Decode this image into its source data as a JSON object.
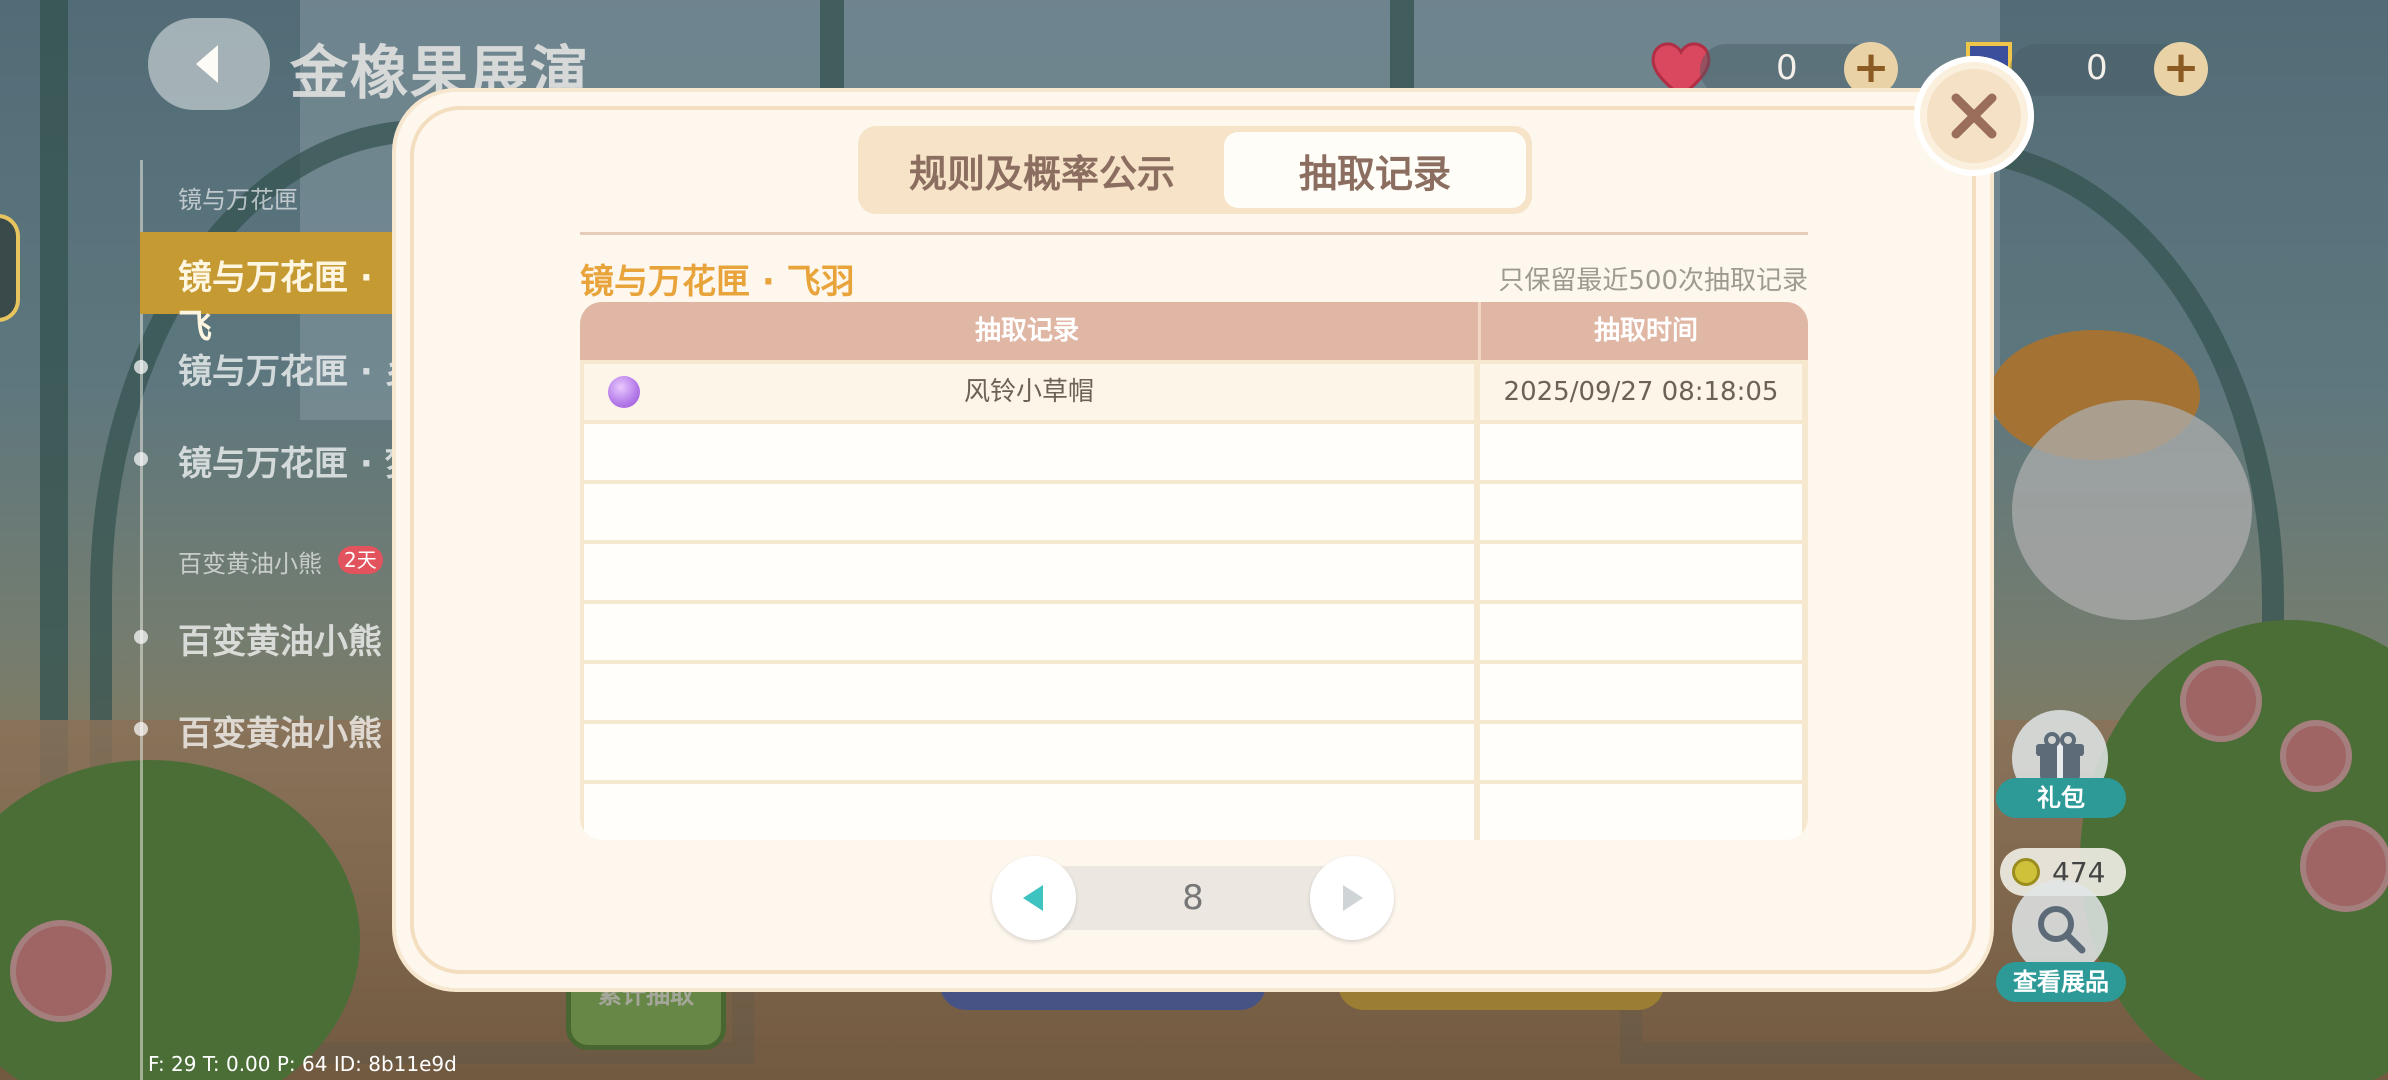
{
  "header": {
    "title": "金橡果展演",
    "currencies": [
      {
        "name": "heart",
        "value": "0"
      },
      {
        "name": "badge",
        "value": "0"
      }
    ]
  },
  "sidebar": {
    "groups": [
      {
        "label": "镜与万花匣",
        "items": [
          "镜与万花匣 · 飞",
          "镜与万花匣 · 乡",
          "镜与万花匣 · 梦"
        ]
      },
      {
        "label": "百变黄油小熊",
        "badge": "2天",
        "items": [
          "百变黄油小熊",
          "百变黄油小熊"
        ]
      }
    ]
  },
  "right_widgets": {
    "gift_label": "礼包",
    "coin_value": "474",
    "view_label": "查看展品"
  },
  "under_buttons": {
    "cumulative_label": "累计抽取"
  },
  "debug": "F: 29   T: 0.00   P: 64   ID: 8b11e9d",
  "dialog": {
    "tabs": [
      {
        "label": "规则及概率公示",
        "active": false
      },
      {
        "label": "抽取记录",
        "active": true
      }
    ],
    "section_title": "镜与万花匣 · 飞羽",
    "keep_note": "只保留最近500次抽取记录",
    "table": {
      "headers": [
        "抽取记录",
        "抽取时间"
      ],
      "rows": [
        {
          "item": "风铃小草帽",
          "time": "2025/09/27 08:18:05",
          "rarity_color": "#b278e8"
        },
        {
          "item": "",
          "time": ""
        },
        {
          "item": "",
          "time": ""
        },
        {
          "item": "",
          "time": ""
        },
        {
          "item": "",
          "time": ""
        },
        {
          "item": "",
          "time": ""
        },
        {
          "item": "",
          "time": ""
        },
        {
          "item": "",
          "time": ""
        }
      ]
    },
    "pager": {
      "page": "8"
    }
  },
  "colors": {
    "accent_orange": "#e8a43a",
    "header_pink": "#e0b6a4",
    "teal": "#2e9a98"
  }
}
